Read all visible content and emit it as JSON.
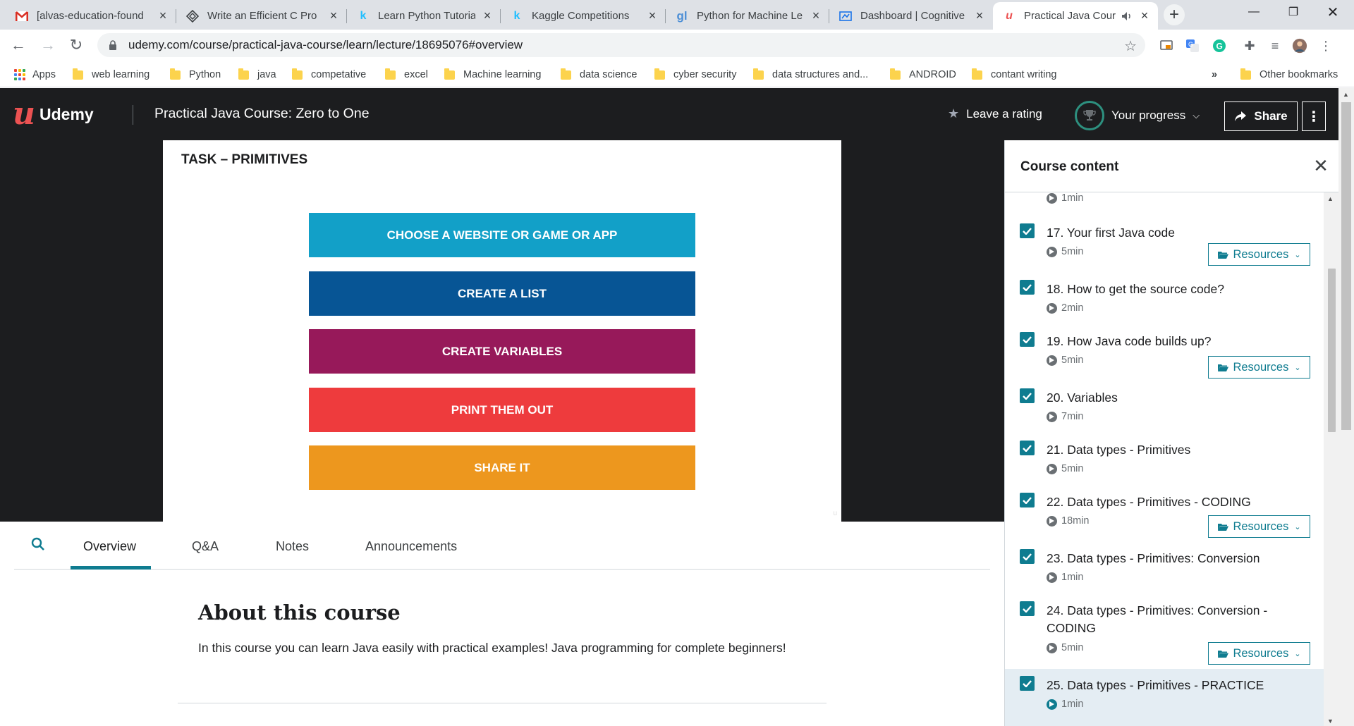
{
  "browser": {
    "tabs": [
      {
        "title": "[alvas-education-found",
        "icon": "gmail-icon"
      },
      {
        "title": "Write an Efficient C Pro",
        "icon": "geeks-icon"
      },
      {
        "title": "Learn Python Tutorials",
        "icon": "kaggle-icon"
      },
      {
        "title": "Kaggle Competitions",
        "icon": "kaggle-icon"
      },
      {
        "title": "Python for Machine Le",
        "icon": "gl-icon"
      },
      {
        "title": "Dashboard | Cognitive",
        "icon": "cognitive-icon"
      },
      {
        "title": "Practical Java Cour",
        "icon": "udemy-icon",
        "active": true
      }
    ],
    "url": "udemy.com/course/practical-java-course/learn/lecture/18695076#overview",
    "bookmarks": [
      "Apps",
      "web learning",
      "Python",
      "java",
      "competative",
      "excel",
      "Machine learning",
      "data science",
      "cyber security",
      "data structures and...",
      "ANDROID",
      "contant writing"
    ],
    "bookmarks_overflow": "»",
    "other_bookmarks": "Other bookmarks"
  },
  "header": {
    "logo_text": "Udemy",
    "course_title": "Practical Java Course: Zero to One",
    "leave_rating": "Leave a rating",
    "your_progress": "Your progress",
    "share": "Share"
  },
  "slide": {
    "title": "TASK – PRIMITIVES",
    "tasks": [
      {
        "label": "CHOOSE A WEBSITE OR GAME OR APP",
        "color": "#12a0c8"
      },
      {
        "label": "CREATE A LIST",
        "color": "#075595"
      },
      {
        "label": "CREATE VARIABLES",
        "color": "#97195a"
      },
      {
        "label": "PRINT THEM OUT",
        "color": "#ee3b3d"
      },
      {
        "label": "SHARE IT",
        "color": "#ed971e"
      }
    ]
  },
  "content_tabs": [
    "Overview",
    "Q&A",
    "Notes",
    "Announcements"
  ],
  "about": {
    "title": "About this course",
    "description": "In this course you can learn Java easily with practical examples! Java programming for complete beginners!"
  },
  "sidebar": {
    "title": "Course content",
    "top_partial_duration": "1min",
    "resources_label": "Resources",
    "lectures": [
      {
        "title": "17. Your first Java code",
        "duration": "5min",
        "resources": true
      },
      {
        "title": "18. How to get the source code?",
        "duration": "2min",
        "resources": false
      },
      {
        "title": "19. How Java code builds up?",
        "duration": "5min",
        "resources": true
      },
      {
        "title": "20. Variables",
        "duration": "7min",
        "resources": false
      },
      {
        "title": "21. Data types - Primitives",
        "duration": "5min",
        "resources": false
      },
      {
        "title": "22. Data types - Primitives - CODING",
        "duration": "18min",
        "resources": true
      },
      {
        "title": "23. Data types - Primitives: Conversion",
        "duration": "1min",
        "resources": false
      },
      {
        "title": "24. Data types - Primitives: Conversion - CODING",
        "duration": "5min",
        "resources": true
      },
      {
        "title": "25. Data types - Primitives - PRACTICE",
        "duration": "1min",
        "resources": false,
        "current": true
      }
    ]
  },
  "colors": {
    "udemy_red": "#ec5252",
    "teal": "#0f7c90",
    "dark": "#1c1d1f"
  }
}
